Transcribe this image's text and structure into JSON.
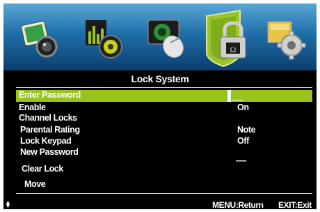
{
  "menu": {
    "tabs": [
      {
        "icon": "picture-icon"
      },
      {
        "icon": "sound-icon"
      },
      {
        "icon": "channel-icon"
      },
      {
        "icon": "lock-icon",
        "active": true
      },
      {
        "icon": "setup-icon"
      }
    ],
    "title": "Lock System",
    "items": [
      {
        "label": "Enter Password",
        "value": ""
      },
      {
        "label": "Enable",
        "value": "On"
      },
      {
        "label": "Channel Locks",
        "value": ""
      },
      {
        "label": "Parental Rating",
        "value": "Note"
      },
      {
        "label": "Lock Keypad",
        "value": "Off"
      },
      {
        "label": "New Password",
        "value": "----"
      },
      {
        "label": "Clear Lock",
        "value": ""
      },
      {
        "label": "Move",
        "value": ""
      }
    ],
    "footer": {
      "return_hint": "MENU:Return",
      "exit_hint": "EXIT:Exit"
    }
  }
}
